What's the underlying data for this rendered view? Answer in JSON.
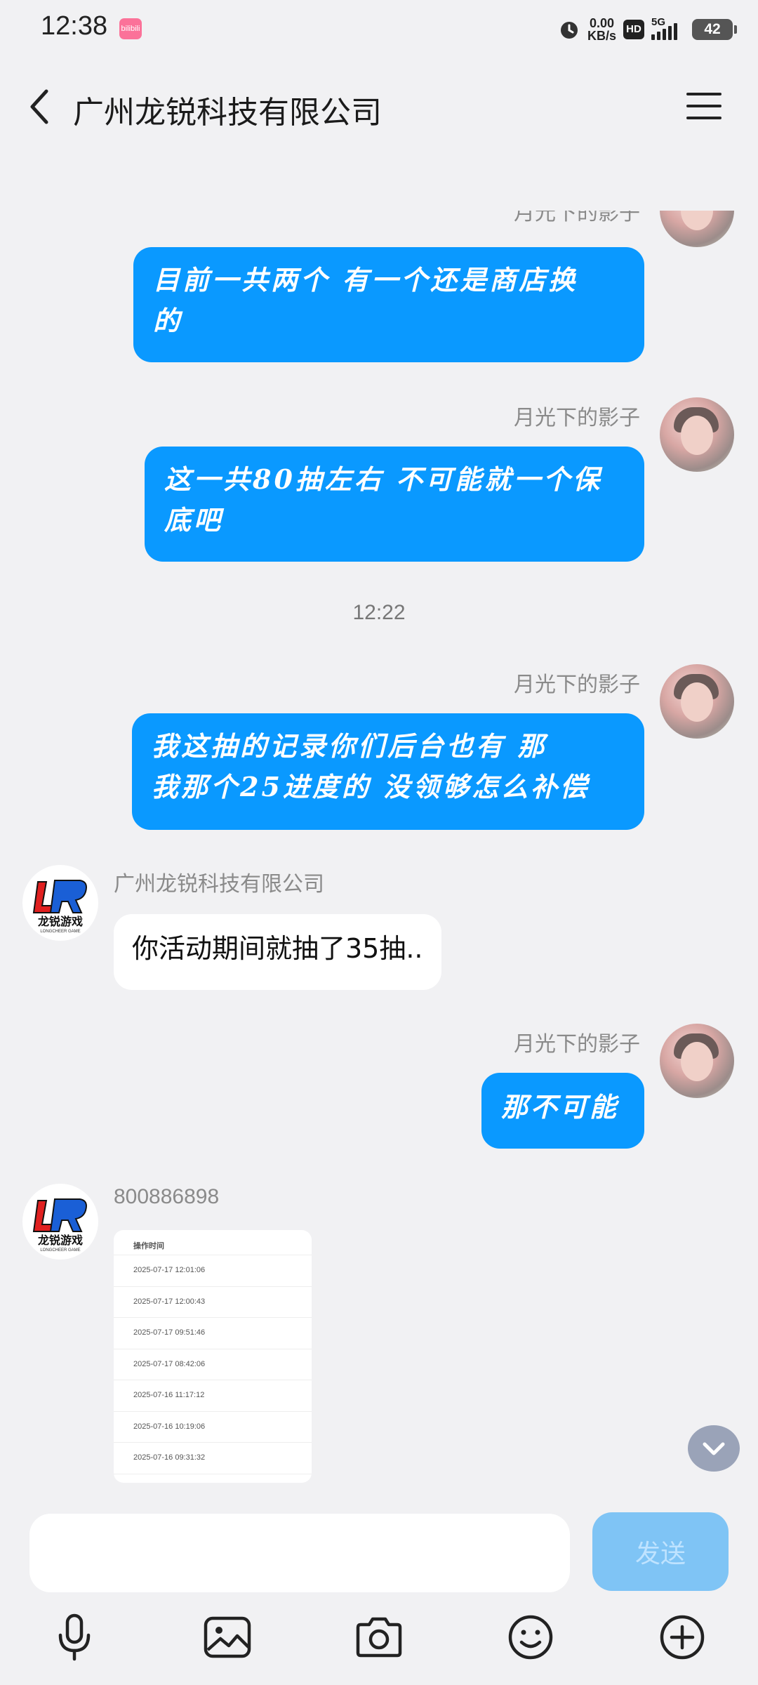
{
  "status_bar": {
    "time": "12:38",
    "app_badge": "bilibili",
    "net_speed_value": "0.00",
    "net_speed_unit": "KB/s",
    "hd": "HD",
    "network": "5G",
    "battery": "42",
    "icons": [
      "alarm-icon",
      "hd-icon",
      "signal-icon",
      "battery-icon"
    ]
  },
  "header": {
    "title": "广州龙锐科技有限公司",
    "back_icon": "chevron-left-icon",
    "menu_icon": "hamburger-menu-icon"
  },
  "messages": {
    "m1": {
      "sender": "月光下的影子",
      "text_line1": "目前一共两个  有一个还是商店换",
      "text_line2": "的"
    },
    "m2": {
      "sender": "月光下的影子",
      "text_line1": "这一共80抽左右 不可能就一个保",
      "text_line2": "底吧"
    },
    "timestamp": "12:22",
    "m3": {
      "sender": "月光下的影子",
      "text_line1": "我这抽的记录你们后台也有   那",
      "text_line2": "我那个25进度的 没领够怎么补偿"
    },
    "m4": {
      "sender": "广州龙锐科技有限公司",
      "text": "你活动期间就抽了35抽.."
    },
    "m5": {
      "sender": "月光下的影子",
      "text": "那不可能"
    },
    "m6": {
      "sender": "800886898",
      "image": {
        "header": "操作时间",
        "rows": [
          "2025-07-17 12:01:06",
          "2025-07-17 12:00:43",
          "2025-07-17 09:51:46",
          "2025-07-17 08:42:06",
          "2025-07-16 11:17:12",
          "2025-07-16 10:19:06",
          "2025-07-16 09:31:32"
        ]
      }
    }
  },
  "company_logo": {
    "text": "龙锐游戏",
    "sub": "LONGCHEER GAME",
    "accent_red": "#e02020",
    "accent_blue": "#1a5fd6"
  },
  "colors": {
    "outgoing_bubble": "#0a99ff",
    "incoming_bubble": "#ffffff",
    "background": "#f1f1f3",
    "send_button": "#7fc4f5"
  },
  "input": {
    "placeholder": "",
    "send_label": "发送"
  },
  "toolbar": [
    "microphone-icon",
    "image-icon",
    "camera-icon",
    "emoji-icon",
    "plus-circle-icon"
  ]
}
